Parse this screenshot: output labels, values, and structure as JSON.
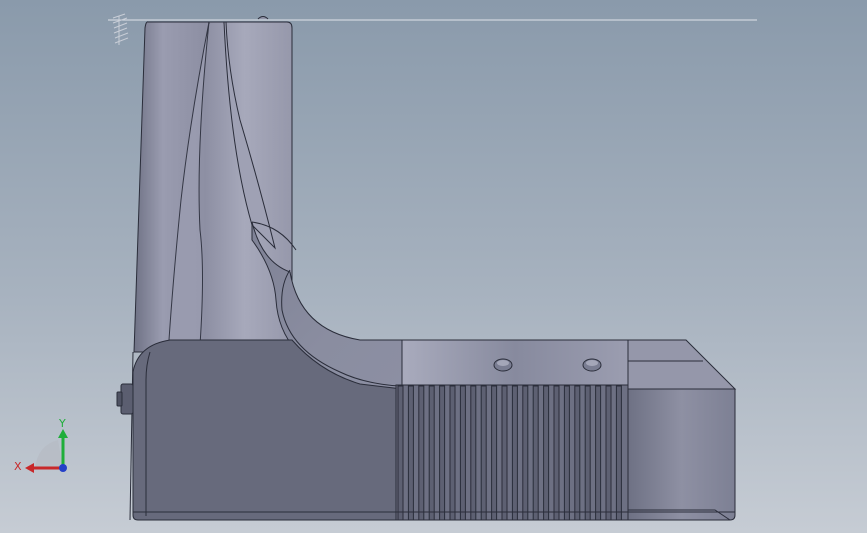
{
  "viewport": {
    "model": "l-shaped-housing",
    "background_colors": [
      "#8a9aab",
      "#c6ccd4"
    ]
  },
  "triad": {
    "x_label": "X",
    "y_label": "Y",
    "x_color": "#c8282a",
    "y_color": "#1fae3a",
    "z_color": "#2440c8"
  }
}
